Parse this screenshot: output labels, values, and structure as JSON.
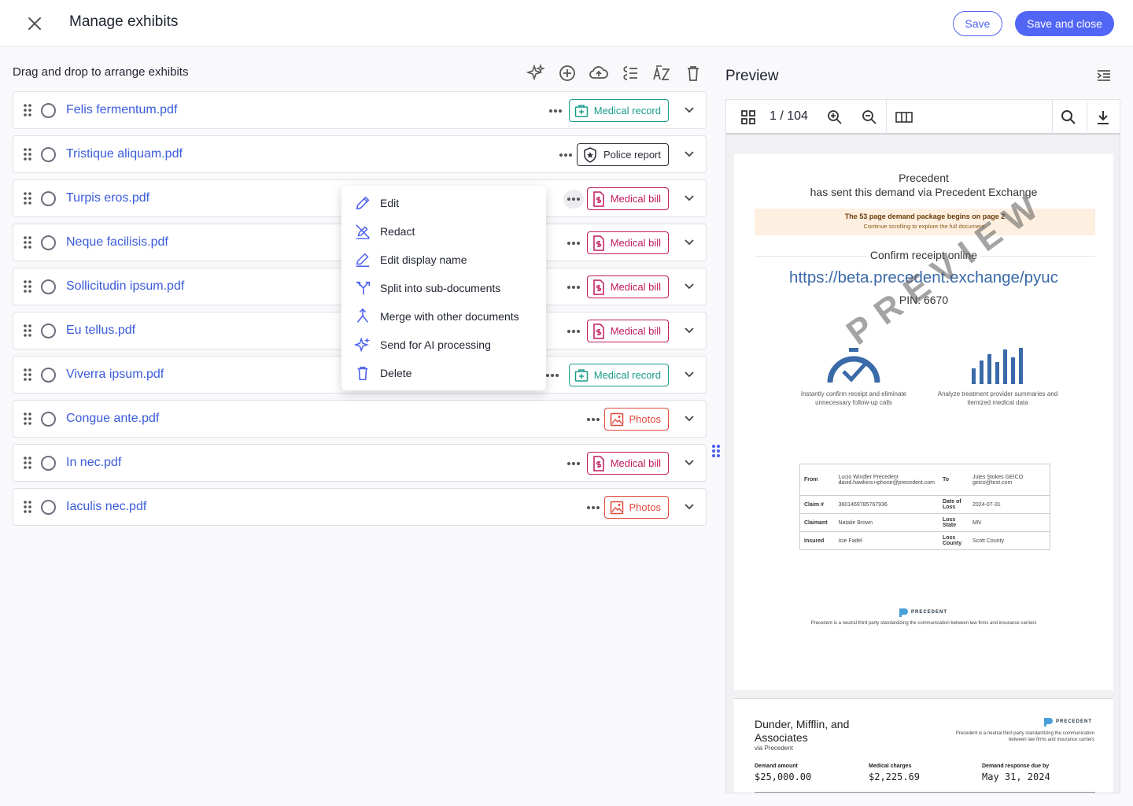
{
  "header": {
    "title": "Manage exhibits",
    "save_label": "Save",
    "save_close_label": "Save and close"
  },
  "left": {
    "heading": "Drag and drop to arrange exhibits",
    "toolbar_icons": [
      "sparkles-icon",
      "add-circle-icon",
      "cloud-upload-icon",
      "list-check-icon",
      "sort-az-icon",
      "trash-icon"
    ]
  },
  "exhibits": [
    {
      "name": "Felis fermentum.pdf",
      "tag": "Medical record",
      "tag_type": "medrec"
    },
    {
      "name": "Tristique aliquam.pdf",
      "tag": "Police report",
      "tag_type": "police"
    },
    {
      "name": "Turpis eros.pdf",
      "tag": "Medical bill",
      "tag_type": "medbill"
    },
    {
      "name": "Neque facilisis.pdf",
      "tag": "Medical bill",
      "tag_type": "medbill"
    },
    {
      "name": "Sollicitudin ipsum.pdf",
      "tag": "Medical bill",
      "tag_type": "medbill"
    },
    {
      "name": "Eu tellus.pdf",
      "tag": "Medical bill",
      "tag_type": "medbill"
    },
    {
      "name": "Viverra ipsum.pdf",
      "tag": "Medical record",
      "tag_type": "medrec"
    },
    {
      "name": "Congue ante.pdf",
      "tag": "Photos",
      "tag_type": "photos"
    },
    {
      "name": "In nec.pdf",
      "tag": "Medical bill",
      "tag_type": "medbill"
    },
    {
      "name": "Iaculis nec.pdf",
      "tag": "Photos",
      "tag_type": "photos"
    }
  ],
  "context_menu": {
    "items": [
      {
        "label": "Edit",
        "icon": "pencil-icon"
      },
      {
        "label": "Redact",
        "icon": "redact-icon"
      },
      {
        "label": "Edit display name",
        "icon": "edit-name-icon"
      },
      {
        "label": "Split into sub-documents",
        "icon": "split-icon"
      },
      {
        "label": "Merge with other documents",
        "icon": "merge-icon"
      },
      {
        "label": "Send for AI processing",
        "icon": "sparkles-icon"
      },
      {
        "label": "Delete",
        "icon": "trash-icon"
      }
    ]
  },
  "preview": {
    "title": "Preview",
    "page_indicator": "1 / 104",
    "page1": {
      "sender": "Precedent",
      "sent_line": "has sent this demand via Precedent Exchange",
      "banner_title": "The 53 page demand package begins on page 2",
      "banner_sub": "Continue scrolling to explore the full document.",
      "confirm_label": "Confirm receipt online",
      "url": "https://beta.precedent.exchange/pyuc",
      "pin": "PIN: 6670",
      "watermark": "PREVIEW",
      "feature1": "Instantly confirm receipt and eliminate unnecessary follow-up calls",
      "feature2": "Analyze treatment provider summaries and itemized medical data",
      "table": {
        "from_label": "From",
        "from_value": "Lucio Windler Precedent david.hawkins+iphone@precedent.com",
        "to_label": "To",
        "to_value": "Jules Stokes GEICO geico@test.com",
        "claim_label": "Claim #",
        "claim_value": "3601469785767936",
        "dol_label": "Date of Loss",
        "dol_value": "2024-07-31",
        "claimant_label": "Claimant",
        "claimant_value": "Natalie Brown",
        "state_label": "Loss State",
        "state_value": "MN",
        "insured_label": "Insured",
        "insured_value": "Icie Fadel",
        "county_label": "Loss County",
        "county_value": "Scott County"
      },
      "logo_text": "PRECEDENT",
      "footer": "Precedent is a neutral third party standardizing the communication between law firms and insurance carriers"
    },
    "page2": {
      "firm": "Dunder, Mifflin, and Associates",
      "via": "via Precedent",
      "logo_text": "PRECEDENT",
      "tagline": "Precedent is a neutral third party standardizing the communication between law firms and insurance carriers",
      "demand_label": "Demand amount",
      "demand_value": "$25,000.00",
      "charges_label": "Medical charges",
      "charges_value": "$2,225.69",
      "due_label": "Demand response due by",
      "due_value": "May 31, 2024"
    }
  },
  "colors": {
    "primary": "#5266f5",
    "link": "#3a5bd9",
    "medical_record": "#1a9b8a",
    "medical_bill": "#c1195d",
    "photos": "#e0483a"
  }
}
